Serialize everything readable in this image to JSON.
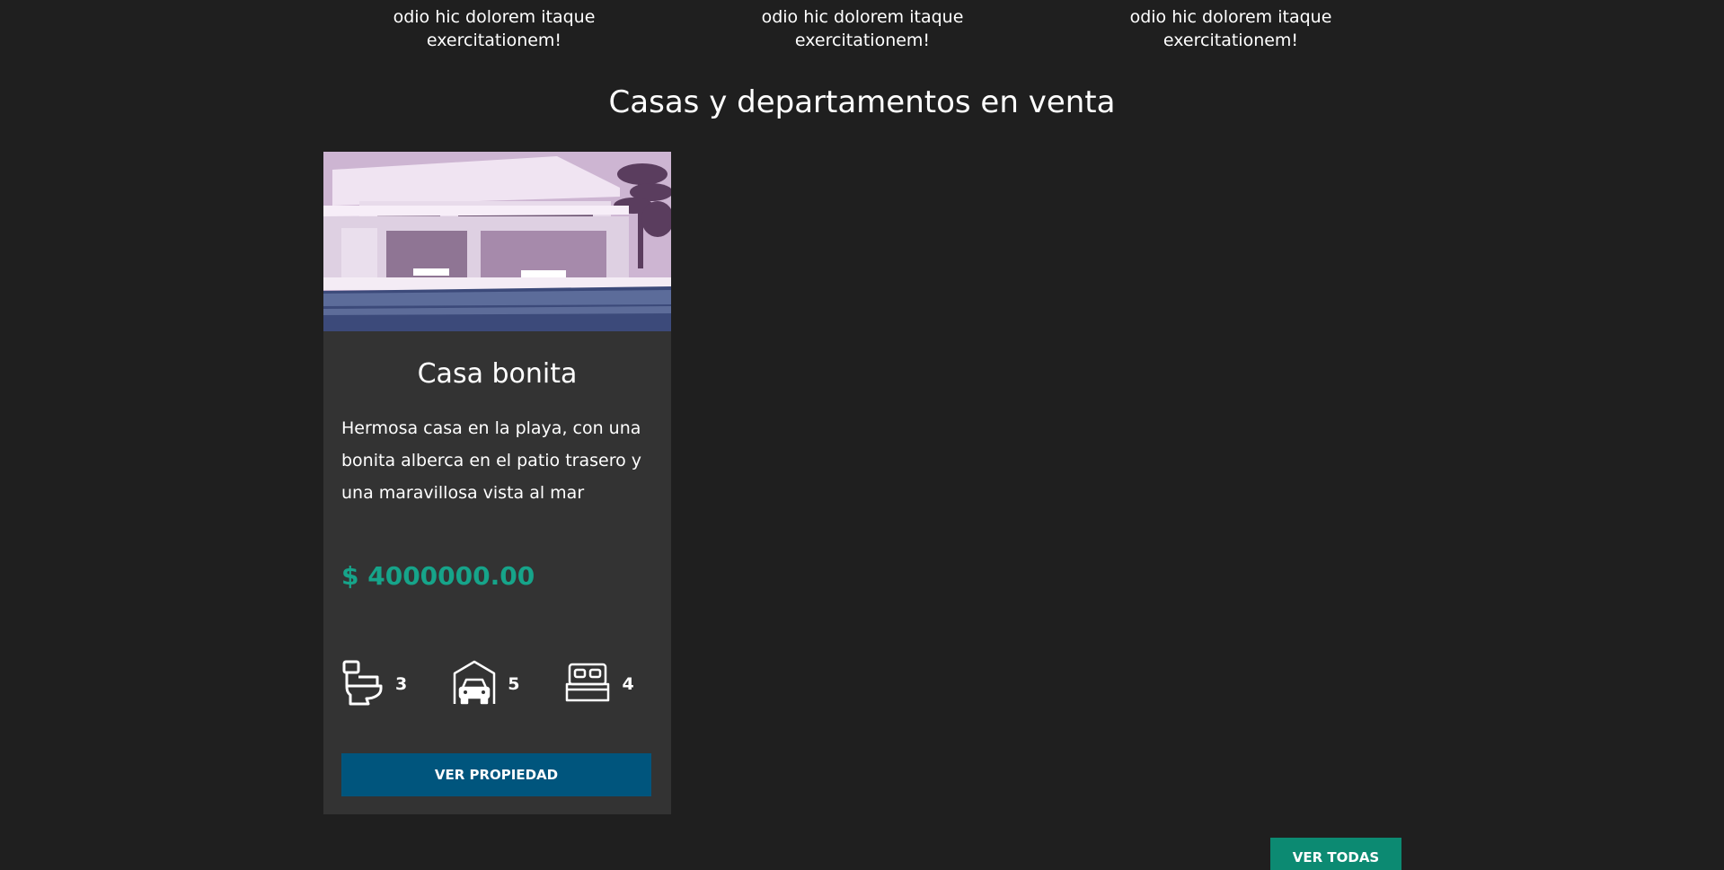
{
  "top_texts": [
    "odio hic dolorem itaque exercitationem!",
    "odio hic dolorem itaque exercitationem!",
    "odio hic dolorem itaque exercitationem!"
  ],
  "section_title": "Casas y departamentos en venta",
  "listing": {
    "image_icon": "house-photo",
    "title": "Casa bonita",
    "description": "Hermosa casa en la playa, con una bonita alberca en el patio trasero y una maravillosa vista al mar",
    "price": "$ 4000000.00",
    "features": {
      "bathrooms": {
        "icon": "toilet-icon",
        "value": "3"
      },
      "parking": {
        "icon": "garage-icon",
        "value": "5"
      },
      "bedrooms": {
        "icon": "bed-icon",
        "value": "4"
      }
    },
    "button_label": "VER PROPIEDAD"
  },
  "view_all_label": "VER TODAS",
  "colors": {
    "background": "#1f1f1f",
    "card": "#333333",
    "price": "#16a48a",
    "primary_button": "#00557d",
    "secondary_button": "#0c8a72"
  }
}
